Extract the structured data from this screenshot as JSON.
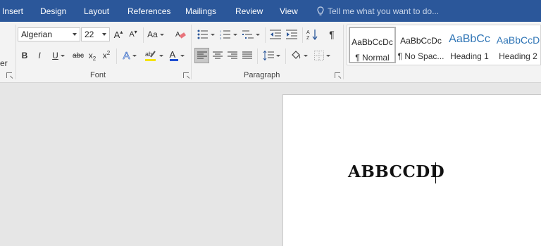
{
  "tabs": [
    "Insert",
    "Design",
    "Layout",
    "References",
    "Mailings",
    "Review",
    "View"
  ],
  "tell_me": "Tell me what you want to do...",
  "cutoff_label": "er",
  "font": {
    "name": "Algerian",
    "size": "22",
    "group_label": "Font",
    "change_case": "Aa",
    "bold": "B",
    "italic": "I",
    "underline": "U",
    "strikethrough": "abc",
    "subscript": "x",
    "superscript": "x",
    "text_effects": "A",
    "font_color": "A",
    "grow": "A",
    "shrink": "A"
  },
  "paragraph": {
    "group_label": "Paragraph",
    "pilcrow": "¶"
  },
  "styles": [
    {
      "sample": "AaBbCcDc",
      "name": "¶ Normal"
    },
    {
      "sample": "AaBbCcDc",
      "name": "¶ No Spac..."
    },
    {
      "sample": "AaBbCc",
      "name": "Heading 1"
    },
    {
      "sample": "AaBbCcD",
      "name": "Heading 2"
    }
  ],
  "document": {
    "text": "ABBCCDD"
  },
  "colors": {
    "tab_bar": "#2b579a",
    "heading_blue": "#2e74b5",
    "font_color_underline": "#1f4fd1",
    "highlight": "#f5e300"
  }
}
